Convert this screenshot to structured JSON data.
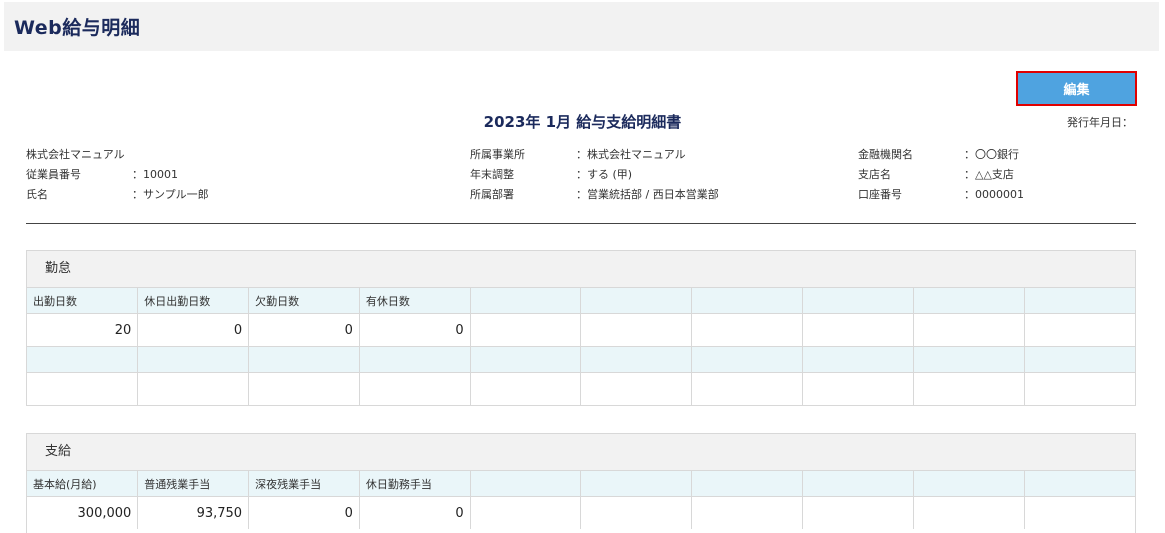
{
  "header": {
    "title": "Web給与明細"
  },
  "toolbar": {
    "edit_label": "編集"
  },
  "document": {
    "title": "2023年 1月 給与支給明細書",
    "issue_date_label": "発行年月日："
  },
  "employee": {
    "company": "株式会社マニュアル",
    "id_label": "従業員番号",
    "id_value": "：10001",
    "name_label": "氏名",
    "name_value": "：サンプル一郎"
  },
  "affiliation": {
    "office_label": "所属事業所",
    "office_value": "：株式会社マニュアル",
    "adjust_label": "年末調整",
    "adjust_value": "：する (甲)",
    "dept_label": "所属部署",
    "dept_value": "：営業統括部 / 西日本営業部"
  },
  "bank": {
    "bank_label": "金融機関名",
    "bank_value": "：〇〇銀行",
    "branch_label": "支店名",
    "branch_value": "：△△支店",
    "account_label": "口座番号",
    "account_value": "：0000001"
  },
  "attendance": {
    "title": "勤怠",
    "headers": [
      "出勤日数",
      "休日出勤日数",
      "欠勤日数",
      "有休日数",
      "",
      "",
      "",
      "",
      "",
      ""
    ],
    "values": [
      "20",
      "0",
      "0",
      "0",
      "",
      "",
      "",
      "",
      "",
      ""
    ]
  },
  "payment": {
    "title": "支給",
    "headers": [
      "基本給(月給)",
      "普通残業手当",
      "深夜残業手当",
      "休日勤務手当",
      "",
      "",
      "",
      "",
      "",
      ""
    ],
    "values": [
      "300,000",
      "93,750",
      "0",
      "0",
      "",
      "",
      "",
      "",
      "",
      ""
    ]
  }
}
